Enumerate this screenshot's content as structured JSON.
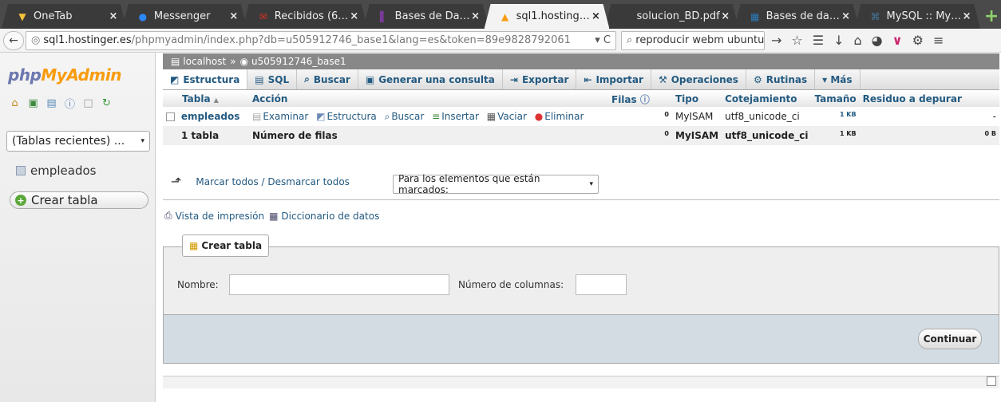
{
  "browser": {
    "tabs": [
      {
        "label": "OneTab",
        "icon": "onetab-icon",
        "color": "#f7c23c"
      },
      {
        "label": "Messenger",
        "icon": "messenger-icon",
        "color": "#2d88ff"
      },
      {
        "label": "Recibidos (6…",
        "icon": "gmail-icon",
        "color": "#d93025"
      },
      {
        "label": "Bases de Da…",
        "icon": "bookmark-icon",
        "color": "#7a3a9a"
      },
      {
        "label": "sql1.hosting…",
        "icon": "pma-icon",
        "color": "#f89c0e",
        "active": true
      },
      {
        "label": "solucion_BD.pdf",
        "icon": "pdf-icon",
        "color": "#888888"
      },
      {
        "label": "Bases de da…",
        "icon": "db-icon",
        "color": "#2b7bb9"
      },
      {
        "label": "MySQL :: My…",
        "icon": "mysql-icon",
        "color": "#4479a1"
      }
    ],
    "url_host": "sql1.hostinger.es",
    "url_path": "/phpmyadmin/index.php?db=u505912746_base1&lang=es&token=89e9828792061",
    "url_tail": "▾ C",
    "search": "reproducir webm ubuntu"
  },
  "sidebar": {
    "logo_php": "php",
    "logo_admin": "MyAdmin",
    "recent_tables": "(Tablas recientes) ...",
    "db_item": "empleados",
    "create_table": "Crear tabla"
  },
  "breadcrumb": {
    "server": "localhost",
    "sep": "»",
    "database": "u505912746_base1"
  },
  "menu": {
    "estructura": "Estructura",
    "sql": "SQL",
    "buscar": "Buscar",
    "generar": "Generar una consulta",
    "exportar": "Exportar",
    "importar": "Importar",
    "operaciones": "Operaciones",
    "rutinas": "Rutinas",
    "mas": "▾ Más"
  },
  "table": {
    "headers": {
      "tabla": "Tabla",
      "sort": "▲",
      "accion": "Acción",
      "filas": "Filas",
      "tipo": "Tipo",
      "cotejamiento": "Cotejamiento",
      "tamano": "Tamaño",
      "residuo": "Residuo a depurar"
    },
    "row": {
      "name": "empleados",
      "examinar": "Examinar",
      "estructura": "Estructura",
      "buscar": "Buscar",
      "insertar": "Insertar",
      "vaciar": "Vaciar",
      "eliminar": "Eliminar",
      "filas": "0",
      "tipo": "MyISAM",
      "cotejamiento": "utf8_unicode_ci",
      "tamano": "1 KB",
      "residuo": "-"
    },
    "summary": {
      "count": "1 tabla",
      "label": "Número de filas",
      "filas": "0",
      "tipo": "MyISAM",
      "cotejamiento": "utf8_unicode_ci",
      "tamano": "1 KB",
      "residuo": "0 B"
    }
  },
  "bulk": {
    "marcar": "Marcar todos / Desmarcar todos",
    "select": "Para los elementos que están marcados:"
  },
  "links": {
    "print": "Vista de impresión",
    "dictionary": "Diccionario de datos"
  },
  "create": {
    "legend": "Crear tabla",
    "nombre_label": "Nombre:",
    "columnas_label": "Número de columnas:",
    "continuar": "Continuar"
  }
}
